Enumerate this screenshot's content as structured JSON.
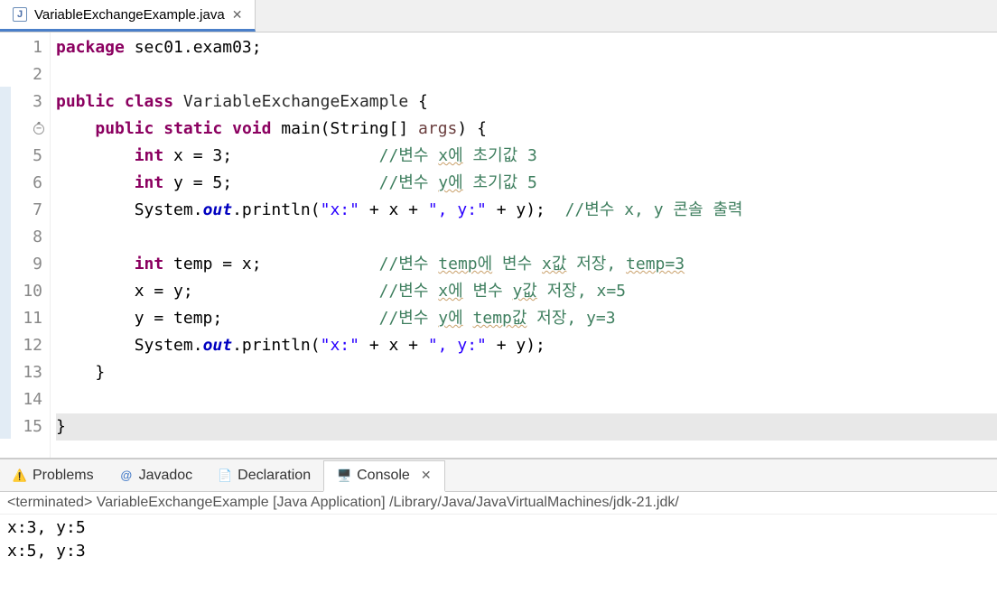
{
  "tab": {
    "filename": "VariableExchangeExample.java"
  },
  "code": {
    "lines": [
      {
        "n": "1",
        "seg": [
          [
            "kw",
            "package"
          ],
          [
            "",
            " sec01.exam03;"
          ]
        ]
      },
      {
        "n": "2",
        "seg": []
      },
      {
        "n": "3",
        "seg": [
          [
            "kw",
            "public"
          ],
          [
            "",
            " "
          ],
          [
            "kw",
            "class"
          ],
          [
            "",
            " "
          ],
          [
            "cls",
            "VariableExchangeExample"
          ],
          [
            "",
            " {"
          ]
        ],
        "blue": true
      },
      {
        "n": "4",
        "seg": [
          [
            "",
            "    "
          ],
          [
            "kw",
            "public"
          ],
          [
            "",
            " "
          ],
          [
            "kw",
            "static"
          ],
          [
            "",
            " "
          ],
          [
            "kw",
            "void"
          ],
          [
            "",
            " main(String[] "
          ],
          [
            "param",
            "args"
          ],
          [
            "",
            ") {"
          ]
        ],
        "fold": true,
        "blue": true
      },
      {
        "n": "5",
        "seg": [
          [
            "",
            "        "
          ],
          [
            "kw",
            "int"
          ],
          [
            "",
            " x = 3;               "
          ],
          [
            "cmt",
            "//변수 "
          ],
          [
            "cmt wavy",
            "x에"
          ],
          [
            "cmt",
            " 초기값 3"
          ]
        ],
        "blue": true
      },
      {
        "n": "6",
        "seg": [
          [
            "",
            "        "
          ],
          [
            "kw",
            "int"
          ],
          [
            "",
            " y = 5;               "
          ],
          [
            "cmt",
            "//변수 "
          ],
          [
            "cmt wavy",
            "y에"
          ],
          [
            "cmt",
            " 초기값 5"
          ]
        ],
        "blue": true
      },
      {
        "n": "7",
        "seg": [
          [
            "",
            "        System."
          ],
          [
            "static-it",
            "out"
          ],
          [
            "",
            ".println("
          ],
          [
            "str",
            "\"x:\""
          ],
          [
            "",
            " + x + "
          ],
          [
            "str",
            "\", y:\""
          ],
          [
            "",
            " + y);  "
          ],
          [
            "cmt",
            "//변수 x, y 콘솔 출력"
          ]
        ],
        "blue": true
      },
      {
        "n": "8",
        "seg": [],
        "blue": true
      },
      {
        "n": "9",
        "seg": [
          [
            "",
            "        "
          ],
          [
            "kw",
            "int"
          ],
          [
            "",
            " temp = x;            "
          ],
          [
            "cmt",
            "//변수 "
          ],
          [
            "cmt wavy",
            "temp에"
          ],
          [
            "cmt",
            " 변수 "
          ],
          [
            "cmt wavy",
            "x값"
          ],
          [
            "cmt",
            " 저장, "
          ],
          [
            "cmt wavy",
            "temp=3"
          ]
        ],
        "blue": true
      },
      {
        "n": "10",
        "seg": [
          [
            "",
            "        x = y;                   "
          ],
          [
            "cmt",
            "//변수 "
          ],
          [
            "cmt wavy",
            "x에"
          ],
          [
            "cmt",
            " 변수 "
          ],
          [
            "cmt wavy",
            "y값"
          ],
          [
            "cmt",
            " 저장, x=5"
          ]
        ],
        "blue": true
      },
      {
        "n": "11",
        "seg": [
          [
            "",
            "        y = temp;                "
          ],
          [
            "cmt",
            "//변수 "
          ],
          [
            "cmt wavy",
            "y에"
          ],
          [
            "cmt",
            " "
          ],
          [
            "cmt wavy",
            "temp값"
          ],
          [
            "cmt",
            " 저장, y=3"
          ]
        ],
        "blue": true
      },
      {
        "n": "12",
        "seg": [
          [
            "",
            "        System."
          ],
          [
            "static-it",
            "out"
          ],
          [
            "",
            ".println("
          ],
          [
            "str",
            "\"x:\""
          ],
          [
            "",
            " + x + "
          ],
          [
            "str",
            "\", y:\""
          ],
          [
            "",
            " + y);"
          ]
        ],
        "blue": true
      },
      {
        "n": "13",
        "seg": [
          [
            "",
            "    }"
          ]
        ],
        "blue": true
      },
      {
        "n": "14",
        "seg": [],
        "blue": true
      },
      {
        "n": "15",
        "seg": [
          [
            "",
            "}"
          ]
        ],
        "blue": true,
        "highlight": true
      }
    ]
  },
  "panel": {
    "tabs": {
      "problems": "Problems",
      "javadoc": "Javadoc",
      "declaration": "Declaration",
      "console": "Console"
    },
    "status": "<terminated> VariableExchangeExample [Java Application] /Library/Java/JavaVirtualMachines/jdk-21.jdk/",
    "output": "x:3, y:5\nx:5, y:3"
  }
}
